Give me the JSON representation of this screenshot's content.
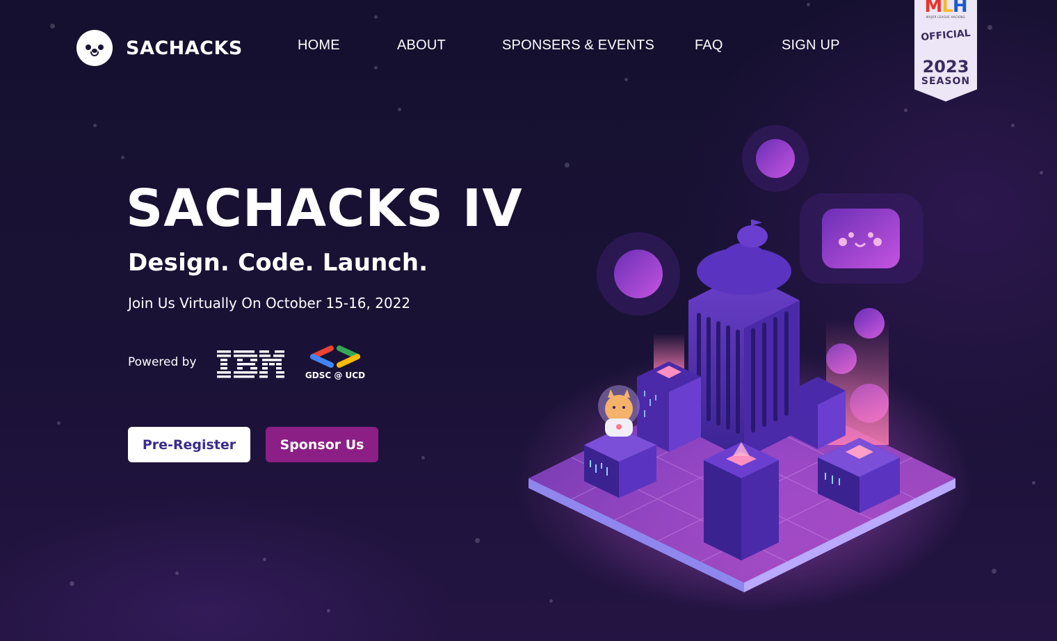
{
  "brand": {
    "name": "SACHACKS",
    "logo_icon": "seal-face-icon"
  },
  "nav": {
    "items": [
      {
        "label": "HOME"
      },
      {
        "label": "ABOUT"
      },
      {
        "label": "SPONSERS & EVENTS"
      },
      {
        "label": "FAQ"
      },
      {
        "label": "SIGN UP"
      }
    ]
  },
  "mlh_badge": {
    "logo": "MLH",
    "small": "MAJOR LEAGUE HACKING",
    "official": "OFFICIAL",
    "year": "2023",
    "season": "SEASON"
  },
  "hero": {
    "title": "SACHACKS IV",
    "tagline": "Design. Code. Launch.",
    "date": "Join Us Virtually On October 15-16, 2022",
    "powered_by": "Powered by",
    "sponsor_logos": [
      {
        "name": "IBM",
        "icon": "ibm-logo"
      },
      {
        "name": "GDSC @ UCD",
        "icon": "gdsc-logo"
      }
    ]
  },
  "buttons": {
    "pre_register": "Pre-Register",
    "sponsor": "Sponsor Us"
  },
  "illustration": {
    "icon": "isometric-city-illustration"
  },
  "colors": {
    "background": "#15102f",
    "accent": "#8b1f85",
    "button_text": "#3b2a8c"
  }
}
